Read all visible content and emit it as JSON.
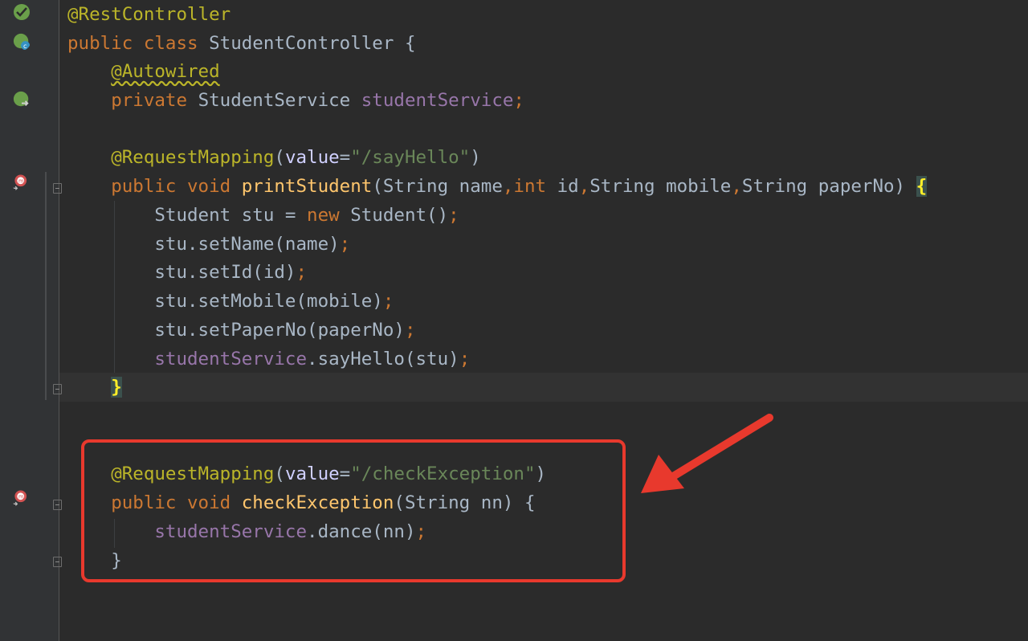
{
  "editor": {
    "lines": {
      "l1": {
        "ann": "@RestController"
      },
      "l2": {
        "kw1": "public",
        "kw2": "class",
        "name": "StudentController",
        "brace": "{"
      },
      "l3": {
        "ann": "@Autowired"
      },
      "l4": {
        "kw": "private",
        "type": "StudentService",
        "field": "studentService",
        "semi": ";"
      },
      "l6": {
        "ann": "@RequestMapping",
        "open": "(",
        "key": "value",
        "eq": "=",
        "val": "\"/sayHello\"",
        "close": ")"
      },
      "l7": {
        "kw1": "public",
        "kw2": "void",
        "fn": "printStudent",
        "p1": "(String name",
        "c1": ",",
        "kwint": "int",
        "p2": " id",
        "c2": ",",
        "p3": "String mobile",
        "c3": ",",
        "p4": "String paperNo) ",
        "brace": "{"
      },
      "l8": {
        "a": "Student stu = ",
        "kw": "new",
        "b": " Student()",
        "semi": ";"
      },
      "l9": {
        "a": "stu.setName(name)",
        "semi": ";"
      },
      "l10": {
        "a": "stu.setId(id)",
        "semi": ";"
      },
      "l11": {
        "a": "stu.setMobile(mobile)",
        "semi": ";"
      },
      "l12": {
        "a": "stu.setPaperNo(paperNo)",
        "semi": ";"
      },
      "l13": {
        "field": "studentService",
        "a": ".sayHello(stu)",
        "semi": ";"
      },
      "l14": {
        "brace": "}"
      },
      "l16": {
        "ann": "@RequestMapping",
        "open": "(",
        "key": "value",
        "eq": "=",
        "val": "\"/checkException\"",
        "close": ")"
      },
      "l17": {
        "kw1": "public",
        "kw2": "void",
        "fn": "checkException",
        "p": "(String nn) {"
      },
      "l18": {
        "field": "studentService",
        "a": ".dance(nn)",
        "semi": ";"
      },
      "l19": {
        "brace": "}"
      }
    }
  },
  "colors": {
    "background": "#2b2b2b",
    "gutter": "#313335",
    "keyword": "#cc7832",
    "annotation": "#bbb529",
    "string": "#6a8759",
    "field": "#9876aa",
    "method": "#ffc66d",
    "highlight_box": "#e8392d",
    "arrow": "#e8392d"
  },
  "gutter_icons": [
    "spring-bean-icon",
    "spring-class-icon",
    "autowired-navigate-icon",
    "request-mapping-icon",
    "request-mapping-icon"
  ]
}
